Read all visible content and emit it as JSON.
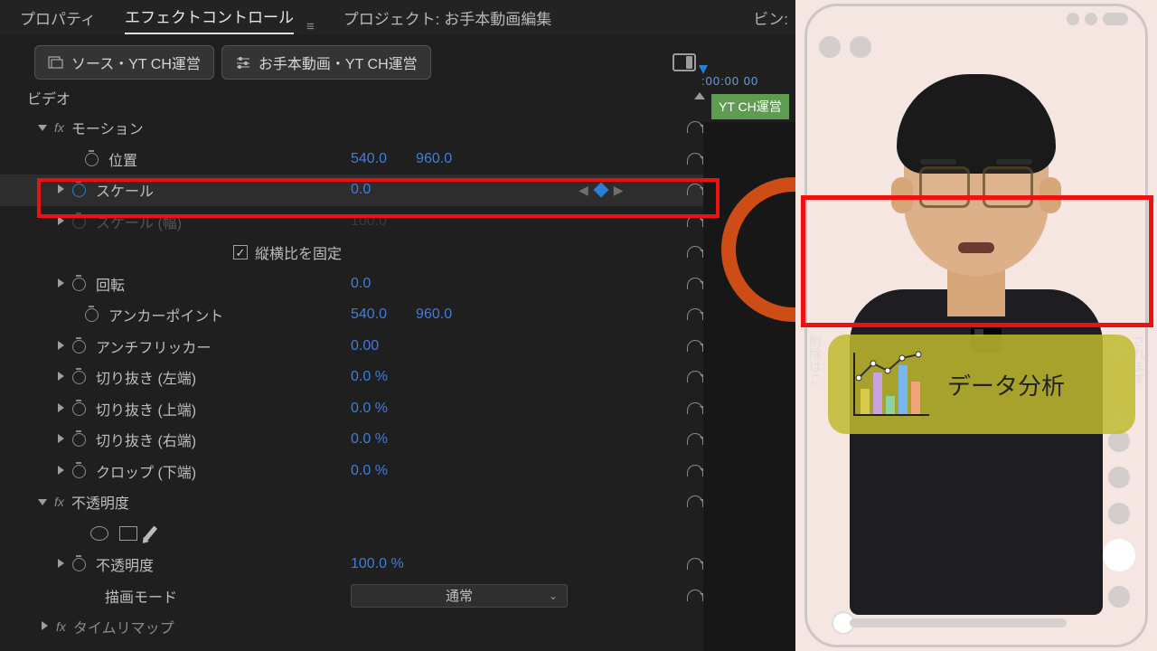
{
  "topbar": {
    "tab_properties": "プロパティ",
    "tab_effect_controls": "エフェクトコントロール",
    "tab_project": "プロジェクト: お手本動画編集",
    "bin_label": "ビン:"
  },
  "chips": {
    "source_label": "ソース・YT CH運営",
    "clip_label": "お手本動画・YT CH運営"
  },
  "timeline": {
    "timecode": ":00:00   00",
    "sequence_chip": "YT CH運営"
  },
  "section": {
    "video": "ビデオ"
  },
  "motion": {
    "group_label": "モーション",
    "position": {
      "label": "位置",
      "x": "540.0",
      "y": "960.0"
    },
    "scale": {
      "label": "スケール",
      "value": "0.0"
    },
    "scale_w": {
      "label": "スケール (幅)",
      "value": "100.0"
    },
    "uniform": {
      "label": "縦横比を固定"
    },
    "rotation": {
      "label": "回転",
      "value": "0.0"
    },
    "anchor": {
      "label": "アンカーポイント",
      "x": "540.0",
      "y": "960.0"
    },
    "antiflicker": {
      "label": "アンチフリッカー",
      "value": "0.00"
    },
    "crop_l": {
      "label": "切り抜き (左端)",
      "value": "0.0 %"
    },
    "crop_t": {
      "label": "切り抜き (上端)",
      "value": "0.0 %"
    },
    "crop_r": {
      "label": "切り抜き (右端)",
      "value": "0.0 %"
    },
    "crop_b": {
      "label": "クロップ (下端)",
      "value": "0.0 %"
    }
  },
  "opacity": {
    "group_label": "不透明度",
    "opacity": {
      "label": "不透明度",
      "value": "100.0 %"
    },
    "blend": {
      "label": "描画モード",
      "value": "通常"
    }
  },
  "timeremap": {
    "group_label": "タイムリマップ"
  },
  "preview": {
    "caption": "データ分析",
    "side_left": "削除はこ",
    "side_right": "されます"
  }
}
